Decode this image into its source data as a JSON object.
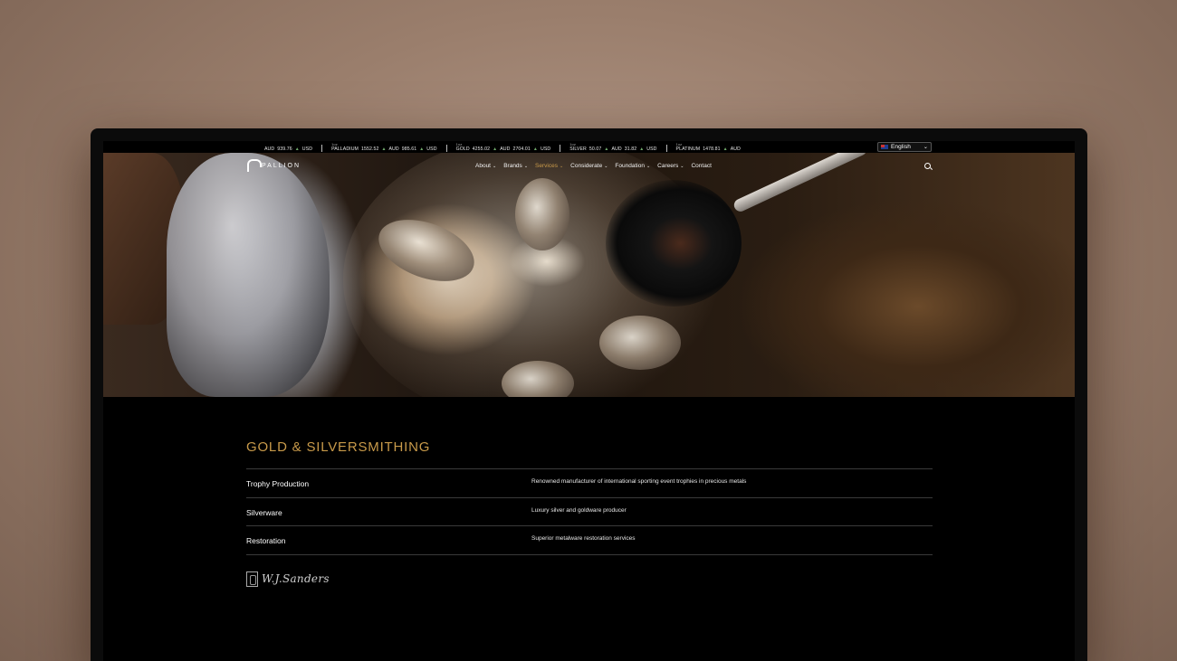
{
  "ticker": {
    "items": [
      {
        "prefix": "",
        "pre": "AUD",
        "metal": "",
        "aud": "939.76",
        "aud_label": "",
        "usd": "",
        "usd_label": "USD"
      },
      {
        "prefix": "1oz",
        "metal": "PALLADIUM",
        "aud": "1552.52",
        "aud_label": "AUD",
        "usd": "985.61",
        "usd_label": "USD"
      },
      {
        "prefix": "1oz",
        "metal": "GOLD",
        "aud": "4255.02",
        "aud_label": "AUD",
        "usd": "2704.01",
        "usd_label": "USD"
      },
      {
        "prefix": "1oz",
        "metal": "SILVER",
        "aud": "50.07",
        "aud_label": "AUD",
        "usd": "31.82",
        "usd_label": "USD"
      },
      {
        "prefix": "1oz",
        "metal": "PLATINUM",
        "aud": "1478.81",
        "aud_label": "AUD",
        "usd": "",
        "usd_label": ""
      }
    ],
    "language": "English"
  },
  "nav": {
    "logo_text": "PALLION",
    "menu": [
      {
        "label": "About"
      },
      {
        "label": "Brands"
      },
      {
        "label": "Services"
      },
      {
        "label": "Considerate"
      },
      {
        "label": "Foundation"
      },
      {
        "label": "Careers"
      },
      {
        "label": "Contact"
      }
    ],
    "accent_color": "#c89a4a"
  },
  "section": {
    "title": "GOLD & SILVERSMITHING",
    "rows": [
      {
        "name": "Trophy Production",
        "desc": "Renowned manufacturer of international sporting event trophies in precious metals"
      },
      {
        "name": "Silverware",
        "desc": "Luxury silver and goldware producer"
      },
      {
        "name": "Restoration",
        "desc": "Superior metalware restoration services"
      }
    ],
    "brand": "W.J.Sanders"
  }
}
